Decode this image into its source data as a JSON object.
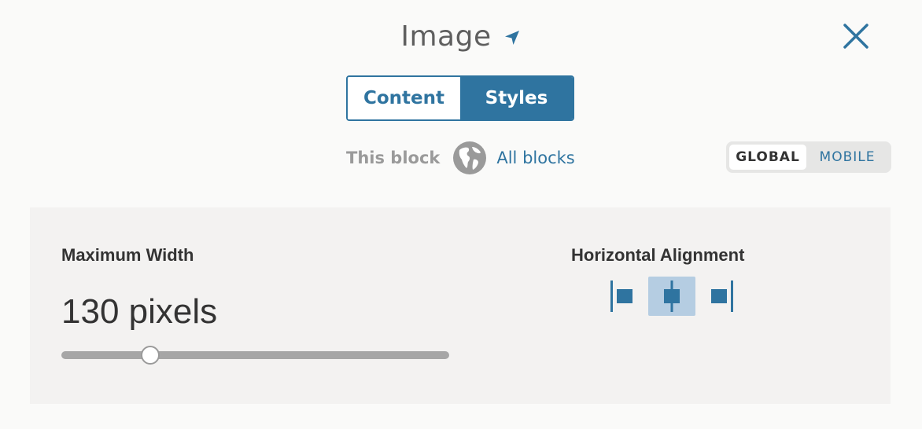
{
  "header": {
    "title": "Image",
    "title_icon": "location-arrow-icon",
    "close_icon": "close-icon"
  },
  "tabs": [
    {
      "label": "Content",
      "active": false
    },
    {
      "label": "Styles",
      "active": true
    }
  ],
  "scope": {
    "this_block_label": "This block",
    "globe_icon": "globe-icon",
    "all_blocks_label": "All blocks"
  },
  "device_toggle": {
    "global_label": "GLOBAL",
    "mobile_label": "MOBILE",
    "selected": "GLOBAL"
  },
  "styles": {
    "max_width": {
      "label": "Maximum Width",
      "value_text": "130 pixels",
      "slider_fraction": 0.23
    },
    "horizontal_alignment": {
      "label": "Horizontal Alignment",
      "options": [
        {
          "name": "align-left-icon",
          "selected": false
        },
        {
          "name": "align-center-icon",
          "selected": true
        },
        {
          "name": "align-right-icon",
          "selected": false
        }
      ]
    }
  },
  "colors": {
    "accent": "#2f74a0",
    "muted_text": "#9a9a9a",
    "selected_bg": "#b5cde2"
  }
}
